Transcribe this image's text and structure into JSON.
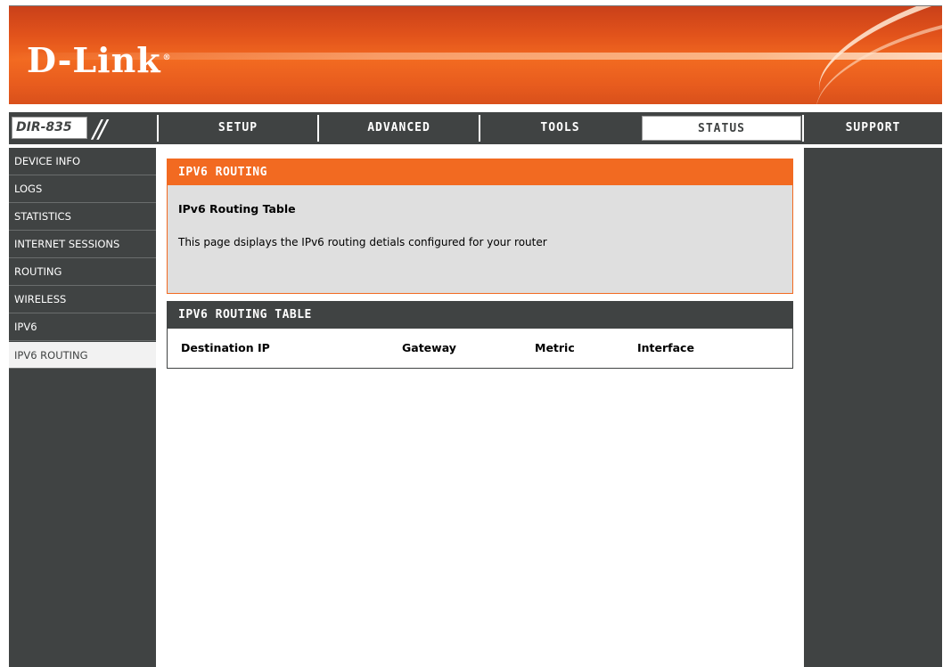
{
  "brand": {
    "logo_text": "D-Link",
    "logo_mark": "®"
  },
  "model": {
    "name": "DIR-835",
    "slashes": "//"
  },
  "nav": {
    "tabs": [
      {
        "label": "SETUP"
      },
      {
        "label": "ADVANCED"
      },
      {
        "label": "TOOLS"
      },
      {
        "label": "STATUS",
        "active": true
      },
      {
        "label": "SUPPORT"
      }
    ]
  },
  "sidebar": {
    "items": [
      {
        "label": "DEVICE INFO"
      },
      {
        "label": "LOGS"
      },
      {
        "label": "STATISTICS"
      },
      {
        "label": "INTERNET SESSIONS"
      },
      {
        "label": "ROUTING"
      },
      {
        "label": "WIRELESS"
      },
      {
        "label": "IPV6"
      },
      {
        "label": "IPV6 ROUTING",
        "active": true
      }
    ]
  },
  "main": {
    "section_title": "IPV6 ROUTING",
    "subtitle": "IPv6 Routing Table",
    "description": "This page dsiplays the IPv6 routing detials configured for your router",
    "table": {
      "title": "IPV6 ROUTING TABLE",
      "columns": [
        "Destination IP",
        "Gateway",
        "Metric",
        "Interface"
      ],
      "rows": []
    }
  },
  "colors": {
    "brand_orange": "#f26a21",
    "dark_gray": "#404343",
    "panel_gray": "#dfdfdf"
  }
}
